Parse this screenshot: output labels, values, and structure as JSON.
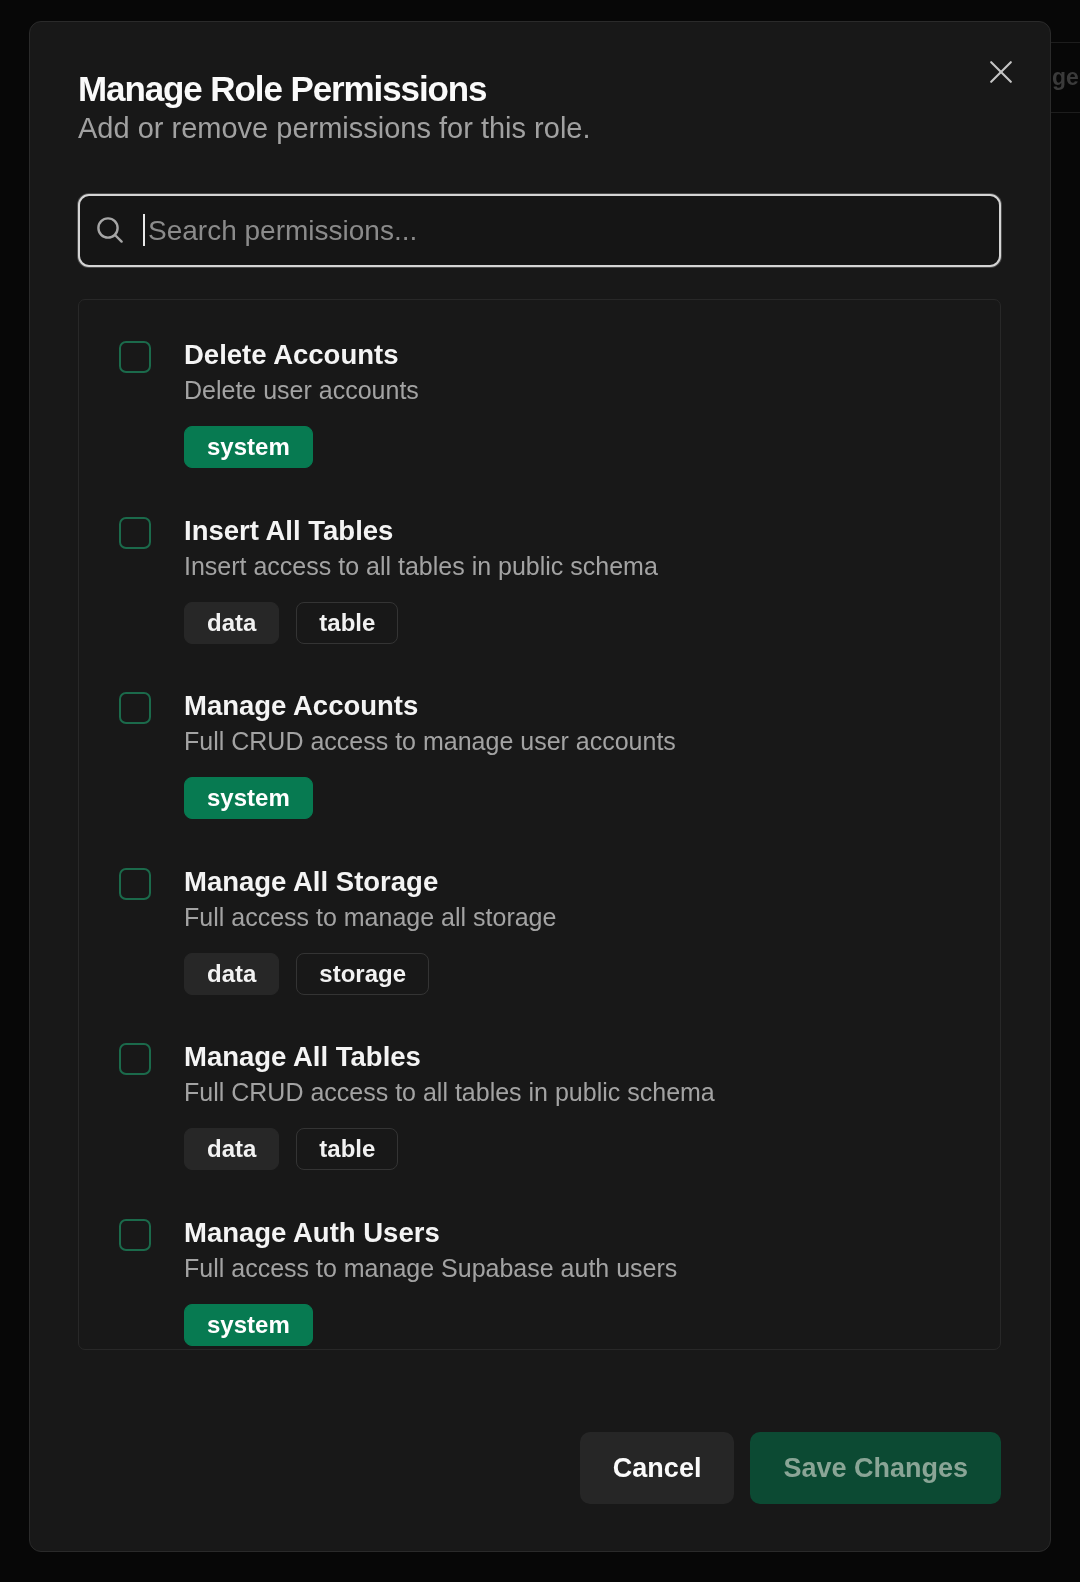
{
  "background_page": {
    "heading_fragment": "ge"
  },
  "dialog": {
    "title": "Manage Role Permissions",
    "subtitle": "Add or remove permissions for this role."
  },
  "search": {
    "placeholder": "Search permissions...",
    "focused": true
  },
  "permissions": [
    {
      "name": "Delete Accounts",
      "description": "Delete user accounts",
      "checked": false,
      "tags": [
        {
          "label": "system",
          "kind": "primary"
        }
      ]
    },
    {
      "name": "Insert All Tables",
      "description": "Insert access to all tables in public schema",
      "checked": false,
      "tags": [
        {
          "label": "data",
          "kind": "secondary"
        },
        {
          "label": "table",
          "kind": "outline"
        }
      ]
    },
    {
      "name": "Manage Accounts",
      "description": "Full CRUD access to manage user accounts",
      "checked": false,
      "tags": [
        {
          "label": "system",
          "kind": "primary"
        }
      ]
    },
    {
      "name": "Manage All Storage",
      "description": "Full access to manage all storage",
      "checked": false,
      "tags": [
        {
          "label": "data",
          "kind": "secondary"
        },
        {
          "label": "storage",
          "kind": "outline"
        }
      ]
    },
    {
      "name": "Manage All Tables",
      "description": "Full CRUD access to all tables in public schema",
      "checked": false,
      "tags": [
        {
          "label": "data",
          "kind": "secondary"
        },
        {
          "label": "table",
          "kind": "outline"
        }
      ]
    },
    {
      "name": "Manage Auth Users",
      "description": "Full access to manage Supabase auth users",
      "checked": false,
      "tags": [
        {
          "label": "system",
          "kind": "primary"
        }
      ]
    }
  ],
  "buttons": [
    {
      "label": "Cancel",
      "kind": "secondary",
      "disabled": false
    },
    {
      "label": "Save Changes",
      "kind": "primary",
      "disabled": true
    }
  ]
}
